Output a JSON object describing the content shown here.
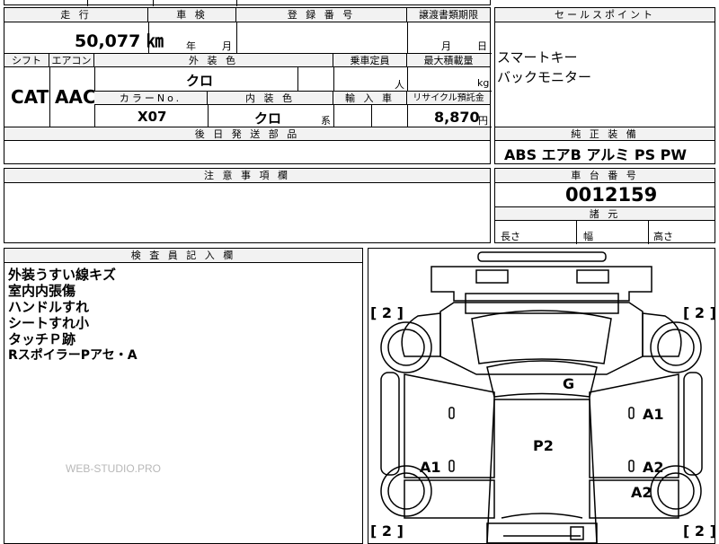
{
  "top_row": {
    "left_text": "",
    "mid_text": "",
    "right_text": ""
  },
  "main": {
    "mileage_label": "走 行",
    "mileage_value": "50,077 ㎞",
    "inspection_label": "車 検",
    "inspection_year": "年",
    "inspection_month": "月",
    "registration_label": "登 録 番 号",
    "transfer_label": "譲渡書類期限",
    "transfer_month": "月",
    "transfer_day": "日",
    "shift_label": "シフト",
    "shift_value": "CAT",
    "aircon_label": "エアコン",
    "aircon_value": "AAC",
    "exterior_label": "外 装 色",
    "exterior_value": "クロ",
    "capacity_label": "乗車定員",
    "capacity_unit": "人",
    "maxload_label": "最大積載量",
    "maxload_unit": "kg",
    "colorno_label": "カラーNo.",
    "colorno_value": "X07",
    "interior_label": "内 装 色",
    "interior_value": "クロ",
    "interior_suffix": "系",
    "import_label": "輸 入 車",
    "recycle_label": "リサイクル預託金",
    "recycle_value": "8,870",
    "recycle_unit": "円",
    "later_parts_label": "後 日 発 送 部 品"
  },
  "sales": {
    "label": "セールスポイント",
    "lines": [
      "スマートキー",
      "バックモニター"
    ]
  },
  "equipment": {
    "label": "純 正 装 備",
    "value": "ABS エアB アルミ PS PW"
  },
  "notes": {
    "label": "注 意 事 項 欄"
  },
  "chassis": {
    "label": "車 台 番 号",
    "value": "0012159"
  },
  "dimensions": {
    "label": "諸 元",
    "length": "長さ",
    "width": "幅",
    "height": "高さ"
  },
  "inspector": {
    "label": "検 査 員 記 入 欄",
    "lines": [
      "外装うすい線キズ",
      "室内内張傷",
      "ハンドルすれ",
      "シートすれ小",
      "タッチＰ跡",
      "RスポイラーPアセ・A"
    ],
    "watermark": "WEB-STUDIO.PRO"
  },
  "diagram": {
    "bracket_left_top": "[ 2 ]",
    "bracket_right_top": "[ 2 ]",
    "bracket_left_bottom": "[ 2 ]",
    "bracket_right_bottom": "[ 2 ]",
    "mark_g": "G",
    "mark_p2": "P2",
    "mark_a1_right": "A1",
    "mark_a1_left": "A1",
    "mark_a2_mid": "A2",
    "mark_a2_low": "A2"
  }
}
